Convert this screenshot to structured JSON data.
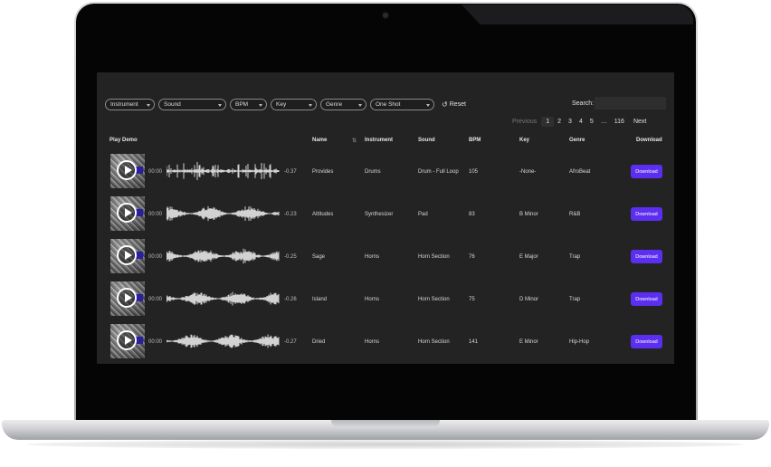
{
  "filters": {
    "instrument": "Instrument",
    "sound": "Sound",
    "bpm": "BPM",
    "key": "Key",
    "genre": "Genre",
    "type": "One Shot",
    "reset": "Reset"
  },
  "search": {
    "label": "Search:",
    "value": ""
  },
  "pagination": {
    "previous": "Previous",
    "pages": [
      "1",
      "2",
      "3",
      "4",
      "5"
    ],
    "ellipsis": "…",
    "last": "116",
    "next": "Next",
    "current": "1"
  },
  "table": {
    "headers": {
      "play_demo": "Play Demo",
      "name": "Name",
      "instrument": "Instrument",
      "sound": "Sound",
      "bpm": "BPM",
      "key": "Key",
      "genre": "Genre",
      "download": "Download"
    },
    "rows": [
      {
        "start": "00:00",
        "end": "-0.37",
        "name": "Provides",
        "instrument": "Drums",
        "sound": "Drum - Full Loop",
        "bpm": "105",
        "key": "-None-",
        "genre": "AfroBeat",
        "download": "Download"
      },
      {
        "start": "00:00",
        "end": "-0.23",
        "name": "Attitudes",
        "instrument": "Synthesizer",
        "sound": "Pad",
        "bpm": "83",
        "key": "B Minor",
        "genre": "R&B",
        "download": "Download"
      },
      {
        "start": "00:00",
        "end": "-0.25",
        "name": "Sage",
        "instrument": "Horns",
        "sound": "Horn Section",
        "bpm": "76",
        "key": "E Major",
        "genre": "Trap",
        "download": "Download"
      },
      {
        "start": "00:00",
        "end": "-0.26",
        "name": "Island",
        "instrument": "Horns",
        "sound": "Horn Section",
        "bpm": "75",
        "key": "D Minor",
        "genre": "Trap",
        "download": "Download"
      },
      {
        "start": "00:00",
        "end": "-0.27",
        "name": "Dried",
        "instrument": "Horns",
        "sound": "Horn Section",
        "bpm": "141",
        "key": "E Minor",
        "genre": "Hip-Hop",
        "download": "Download"
      }
    ]
  },
  "colors": {
    "accent": "#5b2ef0",
    "screen_bg": "#232323",
    "waveform": "#ffffff"
  }
}
